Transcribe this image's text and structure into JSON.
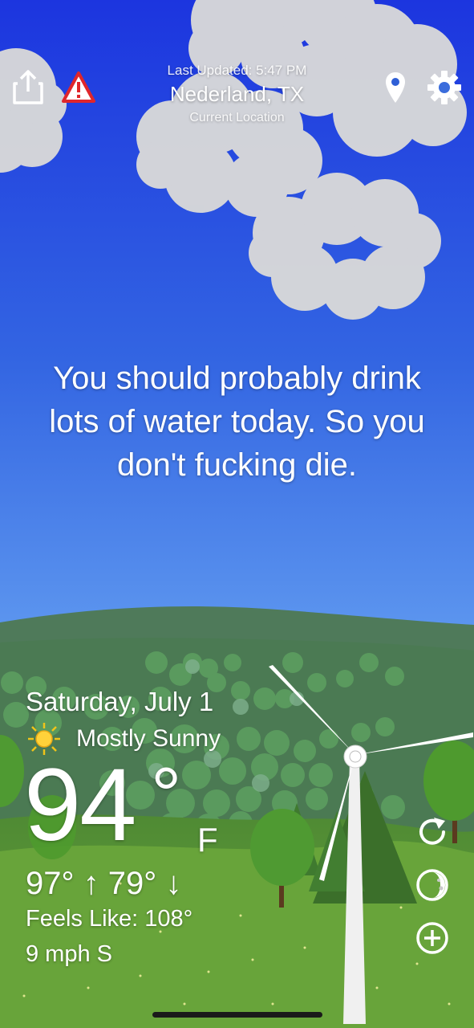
{
  "header": {
    "last_updated": "Last Updated: 5:47 PM",
    "location": "Nederland, TX",
    "location_sub": "Current Location"
  },
  "icons": {
    "share": "share-icon",
    "alert": "alert-triangle-icon",
    "location": "map-pin-icon",
    "settings": "gear-icon",
    "refresh": "refresh-icon",
    "moon": "moon-icon",
    "add": "add-circle-icon"
  },
  "message": "You should probably drink lots of water today. So you don't fucking die.",
  "forecast": {
    "date": "Saturday, July 1",
    "condition": "Mostly Sunny",
    "temperature": "94",
    "degree_symbol": "°",
    "unit": "F",
    "hi_lo": "97° ↑  79° ↓",
    "feels_like": "Feels Like: 108°",
    "wind": "9 mph S"
  },
  "colors": {
    "sky_top": "#1f3fe0",
    "sky_bottom": "#6aa8f5",
    "grass": "#5e9a36",
    "alert_red": "#e0262b"
  }
}
